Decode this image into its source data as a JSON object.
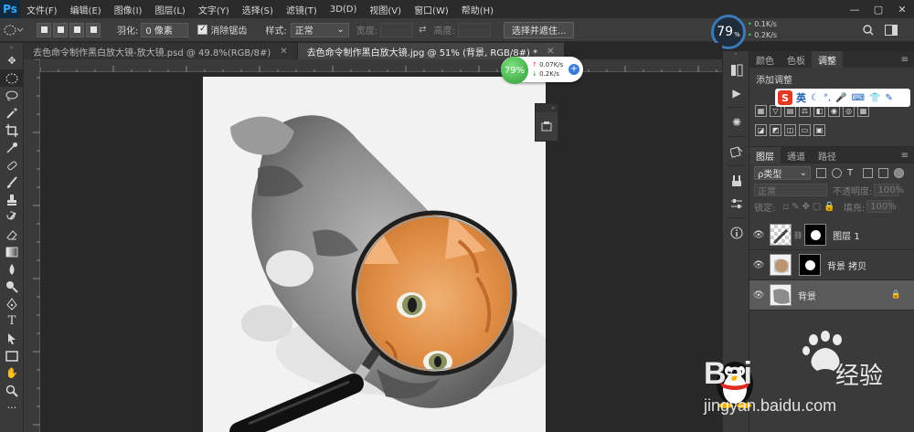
{
  "app": {
    "logo_text": "Ps",
    "menu": [
      "文件(F)",
      "编辑(E)",
      "图像(I)",
      "图层(L)",
      "文字(Y)",
      "选择(S)",
      "滤镜(T)",
      "3D(D)",
      "视图(V)",
      "窗口(W)",
      "帮助(H)"
    ]
  },
  "options": {
    "feather_label": "羽化:",
    "feather_value": "0 像素",
    "antialias_label": "消除锯齿",
    "style_label": "样式:",
    "style_value": "正常",
    "width_label": "宽度:",
    "height_label": "高度:",
    "select_mask_button": "选择并遮住..."
  },
  "cpu_widget": {
    "percent": "79",
    "percent_sign": "%",
    "up_rate": "0.1K/s",
    "down_rate": "0.2K/s"
  },
  "cpu_floating": {
    "percent": "79%",
    "up_rate": "0.07K/s",
    "down_rate": "0.2K/s"
  },
  "tabs": [
    {
      "label": "去色命令制作黑白放大镜-放大镜.psd @ 49.8%(RGB/8#)",
      "active": false
    },
    {
      "label": "去色命令制作黑白放大镜.jpg @ 51% (背景, RGB/8#) *",
      "active": true
    }
  ],
  "panels": {
    "top_tabs": [
      "颜色",
      "色板",
      "调整"
    ],
    "adjust_title": "添加调整",
    "ime_s": "S",
    "ime_lang": "英",
    "layer_tabs": [
      "图层",
      "通道",
      "路径"
    ],
    "filter_kind": "ρ类型",
    "blend_mode": "正常",
    "opacity_label": "不透明度:",
    "opacity_value": "100%",
    "lock_label": "锁定:",
    "fill_label": "填充:",
    "fill_value": "100%"
  },
  "layers": [
    {
      "name": "图层 1",
      "selected": false
    },
    {
      "name": "背景 拷贝",
      "selected": false
    },
    {
      "name": "背景",
      "selected": true
    }
  ],
  "watermark": {
    "brand": "Bai",
    "brand_cn": "经验",
    "url": "jingyan.baidu.com"
  },
  "colors": {
    "accent_blue": "#31a8ff",
    "panel_bg": "#3a3a3a",
    "menu_bg": "#2b2b2b",
    "baidu_red": "#d6231f"
  }
}
